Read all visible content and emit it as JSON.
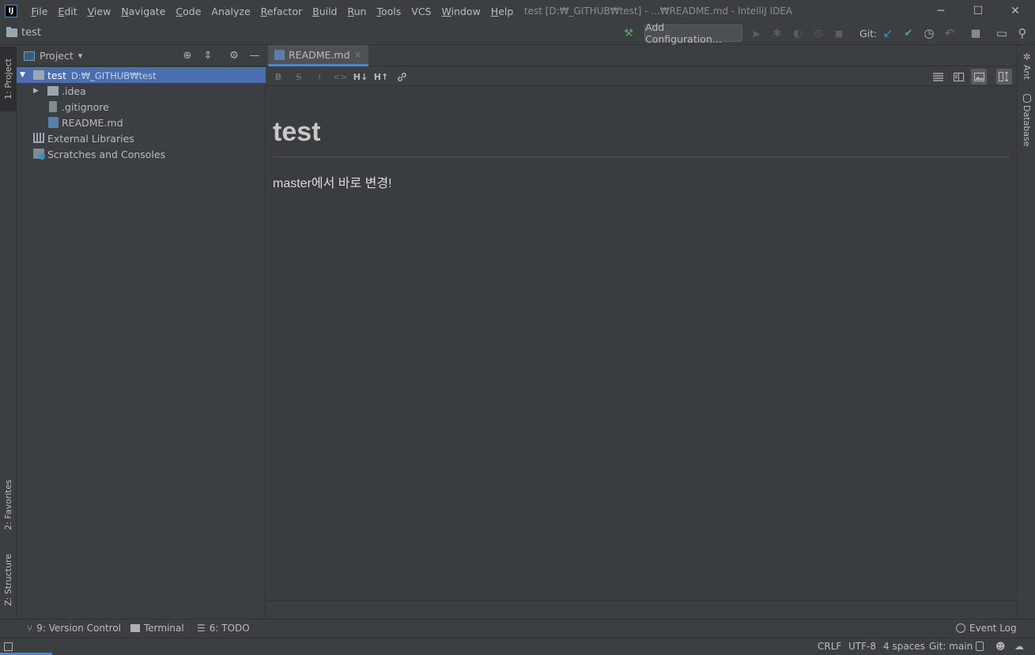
{
  "titlebar": {
    "app_icon": "IJ",
    "menus": [
      {
        "label": "File",
        "mnemonic": "F",
        "rest": "ile"
      },
      {
        "label": "Edit",
        "mnemonic": "E",
        "rest": "dit"
      },
      {
        "label": "View",
        "mnemonic": "V",
        "rest": "iew"
      },
      {
        "label": "Navigate",
        "mnemonic": "N",
        "rest": "avigate"
      },
      {
        "label": "Code",
        "mnemonic": "C",
        "rest": "ode"
      },
      {
        "label": "Analyze",
        "mnemonic": "",
        "rest": "Analyze"
      },
      {
        "label": "Refactor",
        "mnemonic": "R",
        "rest": "efactor"
      },
      {
        "label": "Build",
        "mnemonic": "B",
        "rest": "uild"
      },
      {
        "label": "Run",
        "mnemonic": "R",
        "rest": "un"
      },
      {
        "label": "Tools",
        "mnemonic": "T",
        "rest": "ools"
      },
      {
        "label": "VCS",
        "mnemonic": "",
        "rest": "VCS"
      },
      {
        "label": "Window",
        "mnemonic": "W",
        "rest": "indow"
      },
      {
        "label": "Help",
        "mnemonic": "H",
        "rest": "elp"
      }
    ],
    "window_title": "test [D:₩_GITHUB₩test] - ...₩README.md - IntelliJ IDEA",
    "minimize_glyph": "─",
    "maximize_glyph": "☐",
    "close_glyph": "✕"
  },
  "navbar": {
    "project_name": "test",
    "add_configuration": "Add Configuration...",
    "git_label": "Git:",
    "icons": {
      "build": "⚒",
      "run": "▶",
      "debug": "✱",
      "coverage": "◐",
      "profile": "◎",
      "stop": "■",
      "git_update": "↙",
      "git_commit": "✔",
      "git_history": "◷",
      "git_rollback": "↶",
      "project_structure": "▦",
      "terminal_frame": "▭",
      "search": "⚲"
    }
  },
  "left_stripe": {
    "project_tab": "1: Project",
    "favorites_tab": "2: Favorites",
    "structure_tab": "Z: Structure"
  },
  "right_stripe": {
    "ant_tab": "Ant",
    "database_tab": "Database"
  },
  "project_panel": {
    "title": "Project",
    "tree": [
      {
        "label": "test",
        "hint": "D:₩_GITHUB₩test",
        "selected": true
      },
      {
        "label": ".idea"
      },
      {
        "label": ".gitignore"
      },
      {
        "label": "README.md"
      },
      {
        "label": "External Libraries"
      },
      {
        "label": "Scratches and Consoles"
      }
    ],
    "icons": {
      "locate": "⊕",
      "collapse": "⇕",
      "settings": "⚙",
      "hide": "—",
      "dropdown": "▾",
      "expanded": "▼",
      "collapsed": "▶"
    }
  },
  "editor": {
    "tab_label": "README.md",
    "tab_close": "×",
    "md_toolbar": [
      "B",
      "S",
      "I",
      "<>",
      "H↓",
      "H↑",
      "🔗"
    ],
    "preview": {
      "heading": "test",
      "paragraph": "master에서 바로 변경!"
    }
  },
  "bottom_stripe": {
    "version_control": "9: Version Control",
    "terminal": "Terminal",
    "todo": "6: TODO",
    "event_log": "Event Log"
  },
  "statusbar": {
    "line_sep": "CRLF",
    "encoding": "UTF-8",
    "indent": "4 spaces",
    "git_branch": "Git: main"
  },
  "colors": {
    "background": "#3c3f41",
    "editor_bg": "#3a3d3f",
    "selection": "#4b6eaf",
    "accent": "#4a88c7",
    "build_green": "#59a869"
  }
}
